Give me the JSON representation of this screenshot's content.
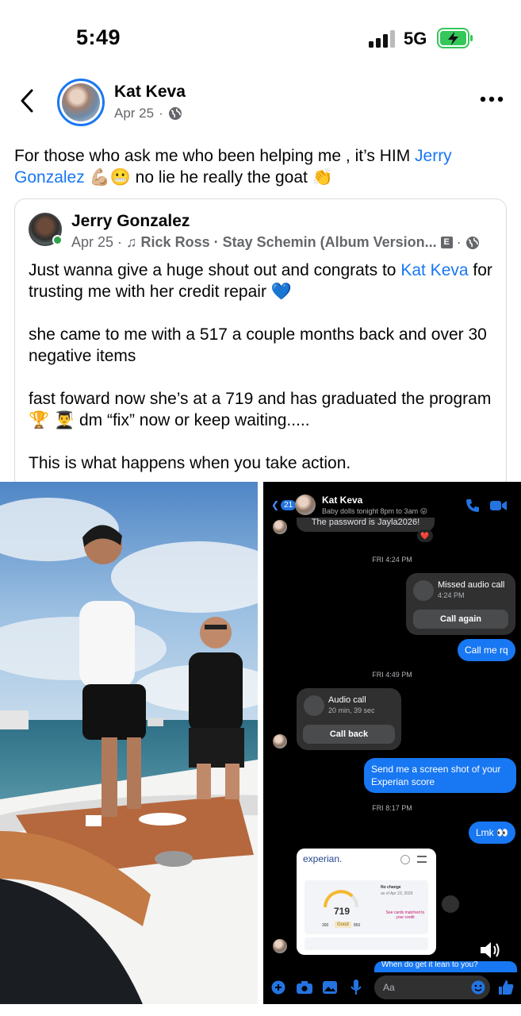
{
  "status_bar": {
    "time": "5:49",
    "network": "5G"
  },
  "post": {
    "author": "Kat Keva",
    "date": "Apr 25",
    "dot": "·",
    "text_before": "For those who ask me who been helping me , it’s HIM ",
    "text_link": "Jerry Gonzalez",
    "text_after": " 💪🏼😬 no lie he really the goat 👏"
  },
  "shared": {
    "author": "Jerry Gonzalez",
    "date": "Apr 25",
    "song_prefix": "· ♫",
    "song": "Rick Ross · Stay Schemin (Album Version...",
    "explicit": "E",
    "body1_before": "Just wanna give a huge shout out and congrats to ",
    "body1_link": "Kat Keva",
    "body1_after": " for trusting me with her credit repair 💙",
    "body2": "she came to me with a 517 a couple months back and over 30 negative items",
    "body3": "fast foward now she’s at a 719 and has graduated the program 🏆 👨‍🎓 dm “fix” now or keep waiting.....",
    "body4": "This is what happens when you take action."
  },
  "messenger": {
    "back_count": "21",
    "name": "Kat Keva",
    "status": "Baby dolls tonight 8pm to 3am 😛",
    "prev_msg": "The password is Jayla2026!",
    "heart": "❤️",
    "ts1": "FRI 4:24 PM",
    "missed_title": "Missed audio call",
    "missed_time": "4:24 PM",
    "call_again": "Call again",
    "msg_call_me": "Call me rq",
    "ts2": "FRI 4:49 PM",
    "audio_title": "Audio call",
    "audio_dur": "20 min, 39 sec",
    "call_back": "Call back",
    "msg_send": "Send me a screen shot of your Experian score",
    "ts3": "FRI 8:17 PM",
    "msg_lmk": "Lmk 👀",
    "experian_logo": "experian.",
    "score": "719",
    "score_low": "300",
    "score_label": "Good",
    "score_high": "850",
    "no_change": "No change",
    "as_of": "as of Apr 23, 2026",
    "see_cards": "See cards matched to your credit",
    "input_placeholder": "Aa",
    "partial_msg": "When do get it lean to you?"
  },
  "colors": {
    "accent": "#1877f2",
    "messenger_blue": "#1877f2",
    "meta_gray": "#65676b"
  }
}
